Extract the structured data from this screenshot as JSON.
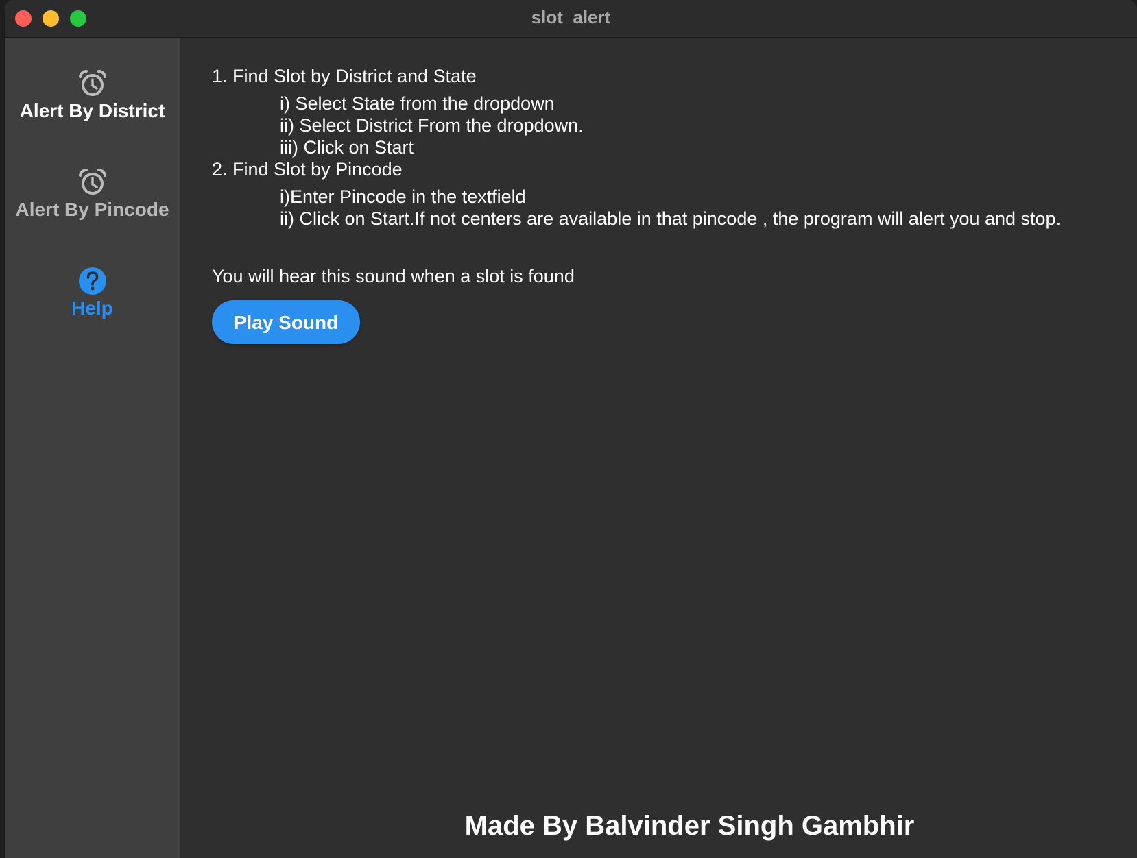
{
  "window": {
    "title": "slot_alert"
  },
  "sidebar": {
    "items": [
      {
        "label": "Alert By District",
        "icon": "alarm-clock-icon",
        "state": "selected"
      },
      {
        "label": "Alert By Pincode",
        "icon": "alarm-clock-icon",
        "state": "normal"
      },
      {
        "label": "Help",
        "icon": "help-circle-icon",
        "state": "active"
      }
    ]
  },
  "help": {
    "step1_title": "1. Find Slot by District and State",
    "step1_items": [
      "i) Select State from the dropdown",
      "ii) Select District From the dropdown.",
      "iii) Click on Start"
    ],
    "step2_title": "2. Find Slot by Pincode",
    "step2_items": [
      "i)Enter  Pincode in the textfield",
      "ii) Click on Start.If not centers are available in  that pincode , the program will alert you and stop."
    ],
    "sound_text": "You will hear this sound when a slot is found",
    "play_button": "Play Sound",
    "footer": "Made By Balvinder Singh Gambhir"
  },
  "colors": {
    "accent": "#2b8ff0",
    "sidebar_bg": "#3f3f3f",
    "content_bg": "#2f2f2f"
  }
}
